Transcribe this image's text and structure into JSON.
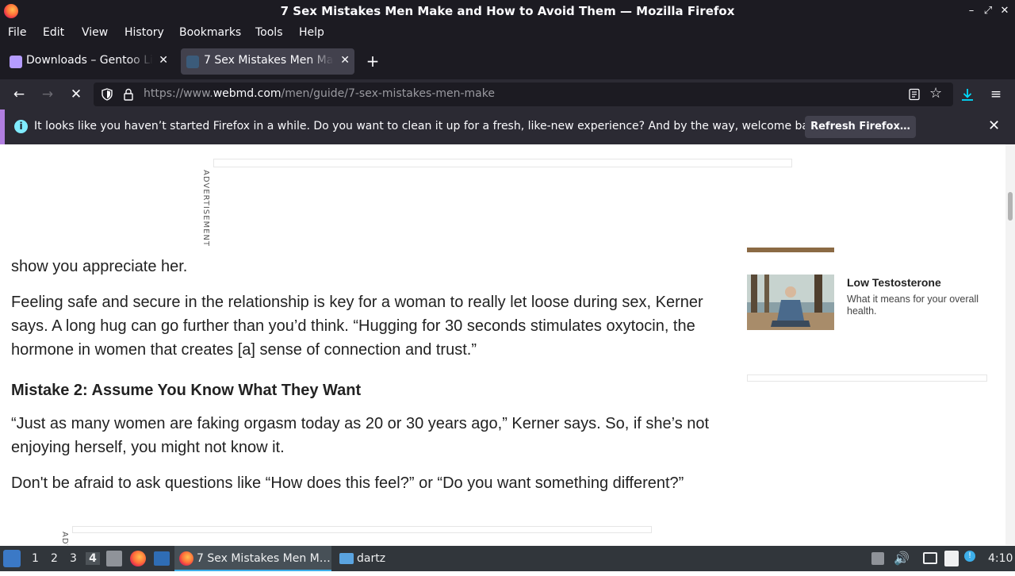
{
  "window": {
    "title": "7 Sex Mistakes Men Make and How to Avoid Them — Mozilla Firefox"
  },
  "menubar": {
    "items": [
      "File",
      "Edit",
      "View",
      "History",
      "Bookmarks",
      "Tools",
      "Help"
    ]
  },
  "tabs": [
    {
      "title": "Downloads – Gentoo Linux",
      "active": false
    },
    {
      "title": "7 Sex Mistakes Men Make and How to Avoid Them",
      "active": true
    }
  ],
  "navbar": {
    "url_prefix": "https://www.",
    "url_domain": "webmd.com",
    "url_path": "/men/guide/7-sex-mistakes-men-make"
  },
  "notification": {
    "message": "It looks like you haven’t started Firefox in a while. Do you want to clean it up for a fresh, like-new experience? And by the way, welcome back!",
    "button": "Refresh Firefox…"
  },
  "ads": {
    "label": "ADVERTISEMENT",
    "label_short": "ADV"
  },
  "article": {
    "partial_line_1": "show you appreciate her.",
    "paragraph_1": "Feeling safe and secure in the relationship is key for a woman to really let loose during sex, Kerner says. A long hug can go further than you’d think. “Hugging for 30 seconds stimulates oxytocin, the hormone in women that creates [a] sense of connection and trust.”",
    "heading_2": "Mistake 2: Assume You Know What They Want",
    "paragraph_2": "“Just as many women are faking orgasm today as 20 or 30 years ago,” Kerner says. So, if she’s not enjoying herself, you might not know it.",
    "paragraph_3": "Don't be afraid to ask questions like “How does this feel?” or “Do you want something different?”"
  },
  "sidebar": {
    "card_title": "Low Testosterone",
    "card_desc": "What it means for your overall health."
  },
  "taskbar": {
    "workspaces": [
      "1",
      "2",
      "3",
      "4"
    ],
    "active_workspace": "4",
    "window_firefox": "7 Sex Mistakes Men M…",
    "window_files": "dartz",
    "clock": "4:10"
  },
  "colors": {
    "chrome_dark": "#1c1b22",
    "toolbar": "#2b2a33",
    "accent_notif": "#b17ee0",
    "download_blue": "#0df"
  }
}
